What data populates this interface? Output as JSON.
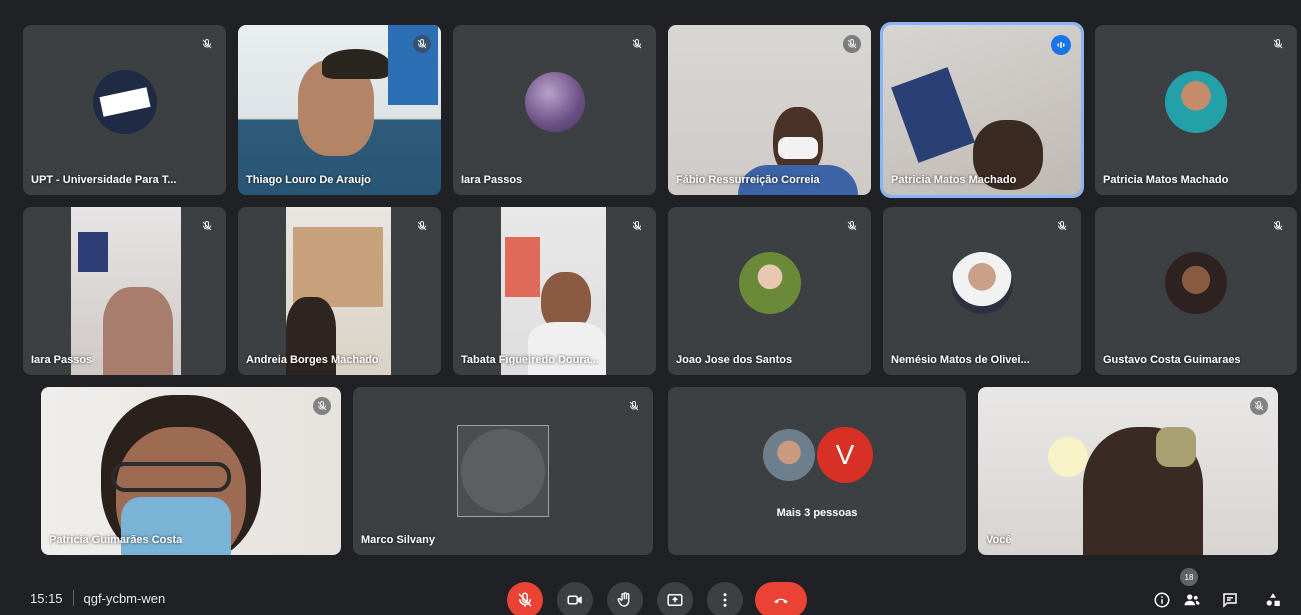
{
  "meeting": {
    "time": "15:15",
    "code": "qgf-ycbm-wen",
    "participant_count": "18"
  },
  "colors": {
    "background": "#202124",
    "tile": "#3c4043",
    "accent": "#8ab4f8",
    "danger": "#ea4335"
  },
  "participants": [
    {
      "name": "UPT - Universidade Para T..."
    },
    {
      "name": "Thiago Louro De Araujo"
    },
    {
      "name": "Iara Passos"
    },
    {
      "name": "Fábio Ressurreição Correia"
    },
    {
      "name": "Patricia Matos Machado"
    },
    {
      "name": "Patricia Matos Machado"
    },
    {
      "name": "Iara Passos"
    },
    {
      "name": "Andreia Borges Machado"
    },
    {
      "name": "Tabata Figueiredo Doura..."
    },
    {
      "name": "Joao Jose dos Santos"
    },
    {
      "name": "Nemésio Matos de Olivei..."
    },
    {
      "name": "Gustavo Costa Guimaraes"
    },
    {
      "name": "Patricia Guimarães Costa"
    },
    {
      "name": "Marco Silvany"
    },
    {
      "name": "Você"
    }
  ],
  "overflow": {
    "label": "Mais 3 pessoas",
    "initial": "V"
  },
  "controls": [
    {
      "icon": "mic-off-icon"
    },
    {
      "icon": "camera-icon"
    },
    {
      "icon": "raise-hand-icon"
    },
    {
      "icon": "present-screen-icon"
    },
    {
      "icon": "more-options-icon"
    },
    {
      "icon": "hang-up-icon"
    }
  ],
  "right_icons": [
    {
      "icon": "info-icon"
    },
    {
      "icon": "people-icon"
    },
    {
      "icon": "chat-icon"
    },
    {
      "icon": "activities-icon"
    }
  ]
}
